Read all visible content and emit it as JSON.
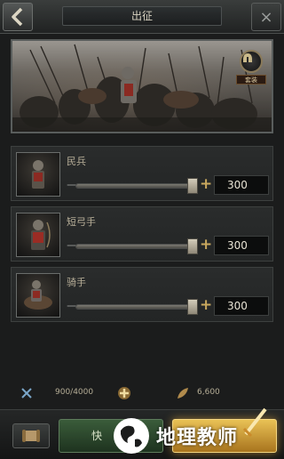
{
  "header": {
    "title": "出征",
    "back_icon": "back-arrow-icon",
    "close_icon": "close-icon"
  },
  "banner": {
    "badge_icon": "helmet-icon",
    "badge_label": "套装"
  },
  "troops": [
    {
      "name": "民兵",
      "count": "300",
      "slider_fraction": 0.96,
      "portrait_icon": "militia-portrait"
    },
    {
      "name": "短弓手",
      "count": "300",
      "slider_fraction": 0.96,
      "portrait_icon": "archer-portrait"
    },
    {
      "name": "骑手",
      "count": "300",
      "slider_fraction": 0.96,
      "portrait_icon": "rider-portrait"
    }
  ],
  "resources": {
    "troop_capacity": "900/4000",
    "troop_icon": "troops-icon",
    "speed_icon": "plus-cross-icon",
    "food_icon": "food-icon",
    "food_value": "6,600"
  },
  "bottom": {
    "scroll_icon": "scroll-icon",
    "quick_label": "快",
    "march_icon": "sword-icon"
  },
  "watermark": {
    "text": "地理教师",
    "logo": "globe-logo"
  },
  "colors": {
    "accent_gold": "#e9c155",
    "quick_green": "#3a5c3a"
  }
}
